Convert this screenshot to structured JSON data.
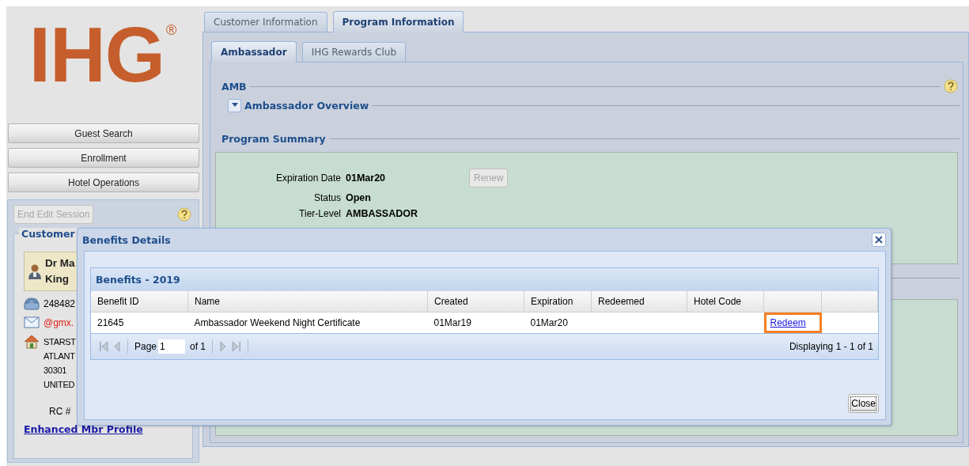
{
  "logo": {
    "text": "IHG",
    "mark": "®"
  },
  "nav_buttons": [
    "Guest Search",
    "Enrollment",
    "Hotel Operations"
  ],
  "session_button": {
    "label": "End Edit Session",
    "disabled": true
  },
  "customer": {
    "legend": "Customer",
    "name_lines": [
      "Dr Ma",
      "King"
    ],
    "phone": "248482",
    "email": "@gmx.",
    "address_lines": [
      "STARST",
      "ATLANT",
      "30301",
      "UNITED"
    ],
    "rc_label": "RC #",
    "profile_link": "Enhanced Mbr Profile"
  },
  "tabs": [
    {
      "label": "Customer Information",
      "selected": false
    },
    {
      "label": "Program Information",
      "selected": true
    }
  ],
  "sub_tabs": [
    {
      "label": "Ambassador",
      "selected": true
    },
    {
      "label": "IHG Rewards Club",
      "selected": false
    }
  ],
  "sections": {
    "amb": "AMB",
    "overview": {
      "title": "Ambassador Overview",
      "expanded": true
    },
    "summary": "Program Summary"
  },
  "summary_fields": [
    {
      "label": "Expiration Date",
      "value": "01Mar20"
    },
    {
      "label": "Status",
      "value": "Open"
    },
    {
      "label": "Tier-Level",
      "value": "AMBASSADOR"
    }
  ],
  "renew_button": {
    "label": "Renew",
    "disabled": true
  },
  "dialog": {
    "title": "Benefits Details",
    "grid_title": "Benefits - 2019",
    "columns": [
      "Benefit ID",
      "Name",
      "Created",
      "Expiration",
      "Redeemed",
      "Hotel Code"
    ],
    "rows": [
      {
        "benefit_id": "21645",
        "name": "Ambassador Weekend Night Certificate",
        "created": "01Mar19",
        "expiration": "01Mar20",
        "action": {
          "label": "Redeem",
          "highlighted": true
        }
      }
    ],
    "pager": {
      "page_label": "Page",
      "page": "1",
      "of_label": "of 1",
      "display": "Displaying 1 - 1 of 1"
    },
    "close_button": "Close"
  }
}
